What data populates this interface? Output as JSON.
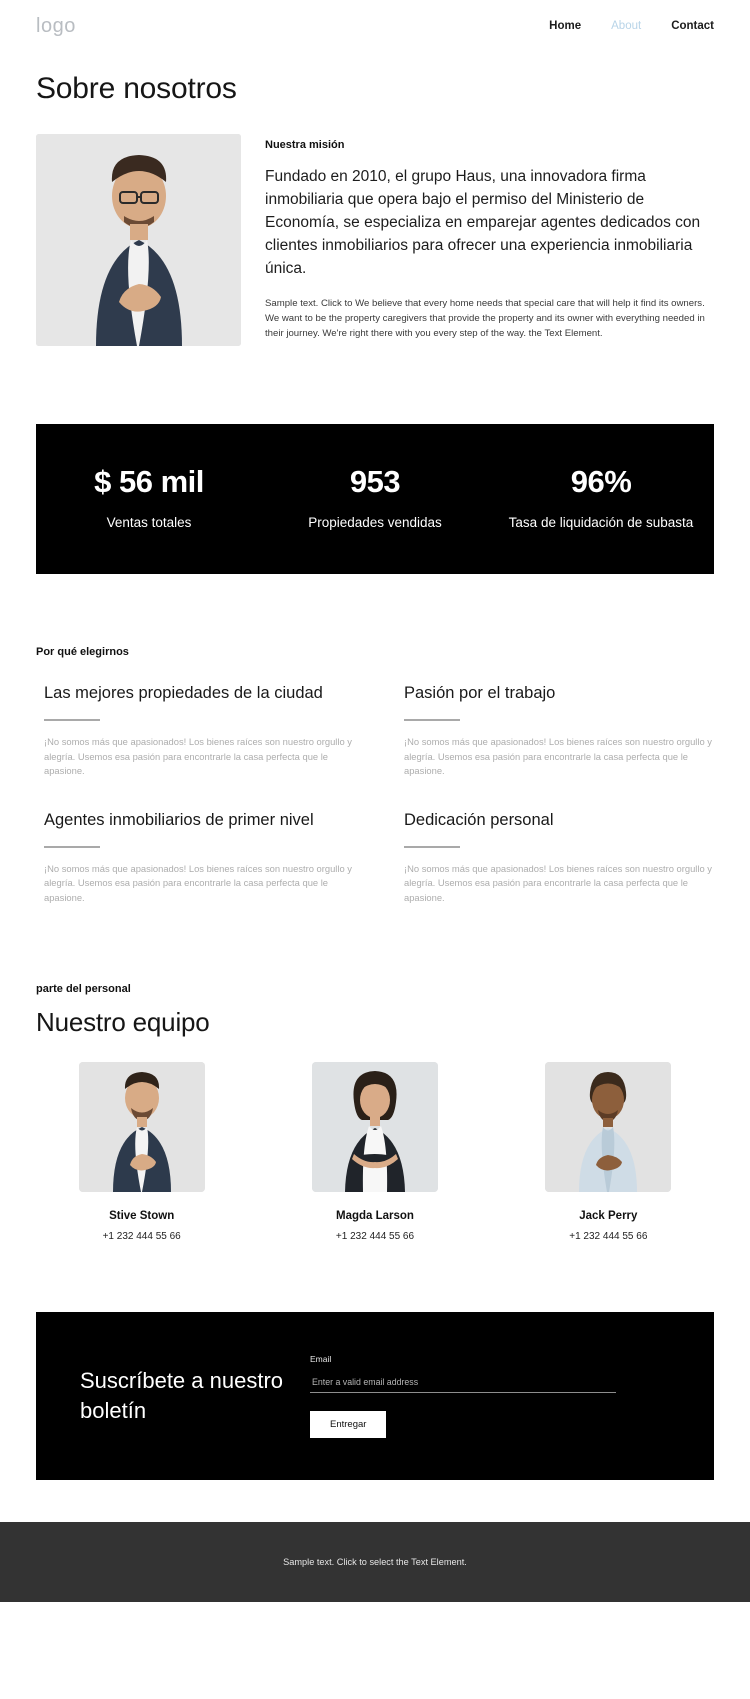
{
  "header": {
    "logo": "logo",
    "nav": [
      {
        "label": "Home",
        "active": false
      },
      {
        "label": "About",
        "active": true
      },
      {
        "label": "Contact",
        "active": false
      }
    ]
  },
  "page_title": "Sobre nosotros",
  "mission": {
    "eyebrow": "Nuestra misión",
    "lead": "Fundado en 2010, el grupo Haus, una innovadora firma inmobiliaria que opera bajo el permiso del Ministerio de Economía, se especializa en emparejar agentes dedicados con clientes inmobiliarios para ofrecer una experiencia inmobiliaria única.",
    "small": "Sample text. Click to We believe that every home needs that special care that will help it find its owners. We want to be the property caregivers that provide the property and its owner with everything needed in their journey. We're right there with you every step of the way. the Text Element.",
    "photo_alt": "portrait-man-glasses"
  },
  "stats": [
    {
      "value": "$ 56 mil",
      "label": "Ventas totales"
    },
    {
      "value": "953",
      "label": "Propiedades vendidas"
    },
    {
      "value": "96%",
      "label": "Tasa de liquidación de subasta"
    }
  ],
  "why": {
    "eyebrow": "Por qué elegirnos",
    "features": [
      {
        "title": "Las mejores propiedades de la ciudad",
        "body": "¡No somos más que apasionados! Los bienes raíces son nuestro orgullo y alegría. Usemos esa pasión para encontrarle la casa perfecta que le apasione."
      },
      {
        "title": "Pasión por el trabajo",
        "body": "¡No somos más que apasionados! Los bienes raíces son nuestro orgullo y alegría. Usemos esa pasión para encontrarle la casa perfecta que le apasione."
      },
      {
        "title": "Agentes inmobiliarios de primer nivel",
        "body": "¡No somos más que apasionados! Los bienes raíces son nuestro orgullo y alegría. Usemos esa pasión para encontrarle la casa perfecta que le apasione."
      },
      {
        "title": "Dedicación personal",
        "body": "¡No somos más que apasionados! Los bienes raíces son nuestro orgullo y alegría. Usemos esa pasión para encontrarle la casa perfecta que le apasione."
      }
    ]
  },
  "team": {
    "eyebrow": "parte del personal",
    "title": "Nuestro equipo",
    "members": [
      {
        "name": "Stive Stown",
        "phone": "+1 232 444 55 66",
        "photo_alt": "portrait-man-beard"
      },
      {
        "name": "Magda Larson",
        "phone": "+1 232 444 55 66",
        "photo_alt": "portrait-woman-curly"
      },
      {
        "name": "Jack Perry",
        "phone": "+1 232 444 55 66",
        "photo_alt": "portrait-man-curly"
      }
    ]
  },
  "newsletter": {
    "title": "Suscríbete a nuestro boletín",
    "email_label": "Email",
    "email_value": "",
    "email_placeholder": "Enter a valid email address",
    "submit_label": "Entregar"
  },
  "footer": {
    "text": "Sample text. Click to select the Text Element."
  },
  "colors": {
    "accent_dark": "#000000",
    "footer_bg": "#333333",
    "muted_text": "#adadad",
    "nav_active": "#b8d4e8"
  }
}
